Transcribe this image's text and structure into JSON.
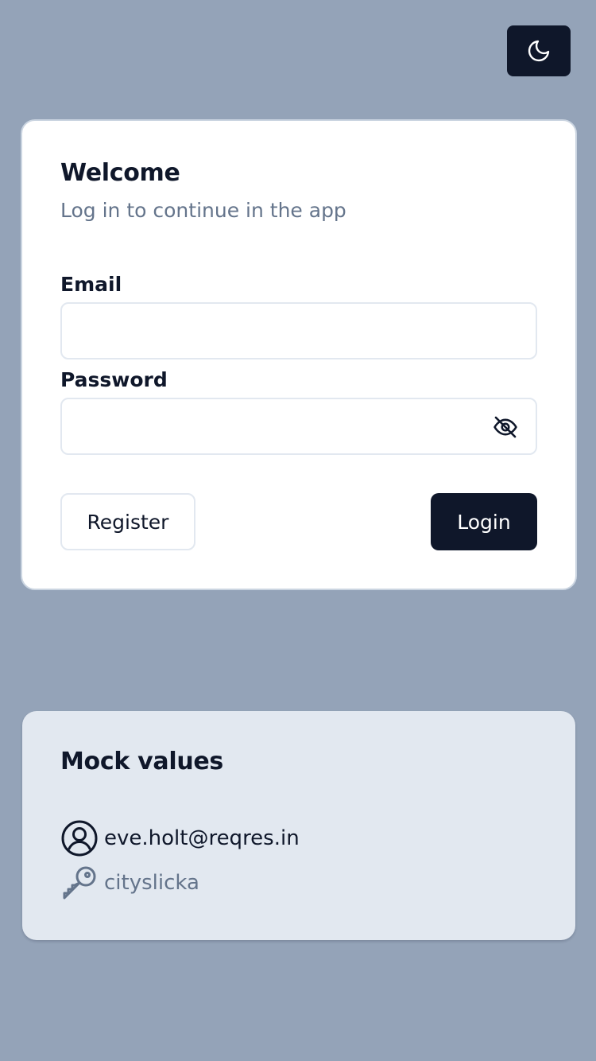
{
  "theme_toggle": {
    "icon": "moon-icon"
  },
  "login": {
    "title": "Welcome",
    "subtitle": "Log in to continue in the app",
    "email_label": "Email",
    "email_value": "",
    "email_placeholder": "",
    "password_label": "Password",
    "password_value": "",
    "password_placeholder": "",
    "password_toggle_icon": "eye-off-icon",
    "register_label": "Register",
    "login_label": "Login"
  },
  "mock": {
    "title": "Mock values",
    "email": "eve.holt@reqres.in",
    "email_icon": "user-circle-icon",
    "password": "cityslicka",
    "password_icon": "key-icon"
  },
  "colors": {
    "background": "#94a3b8",
    "card": "#ffffff",
    "mock_card": "#e2e8f0",
    "primary": "#0f172a",
    "muted_text": "#64748b",
    "border": "#e2e8f0"
  }
}
